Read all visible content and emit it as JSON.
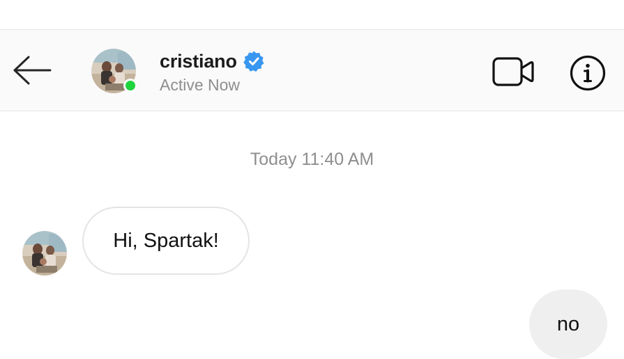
{
  "header": {
    "username": "cristiano",
    "verified": true,
    "presence": "Active Now",
    "online": true
  },
  "icons": {
    "back": "arrow-left-icon",
    "video": "video-camera-icon",
    "info": "info-icon",
    "verified": "verified-badge-icon"
  },
  "colors": {
    "online_dot": "#1fd33d",
    "verified_blue": "#3897f0",
    "incoming_bubble_border": "#e4e4e4",
    "outgoing_bubble_bg": "#efefef",
    "muted_text": "#8e8e8e"
  },
  "thread": {
    "timestamp": "Today 11:40 AM",
    "messages": [
      {
        "direction": "incoming",
        "text": "Hi, Spartak!"
      },
      {
        "direction": "outgoing",
        "text": "no"
      }
    ]
  }
}
